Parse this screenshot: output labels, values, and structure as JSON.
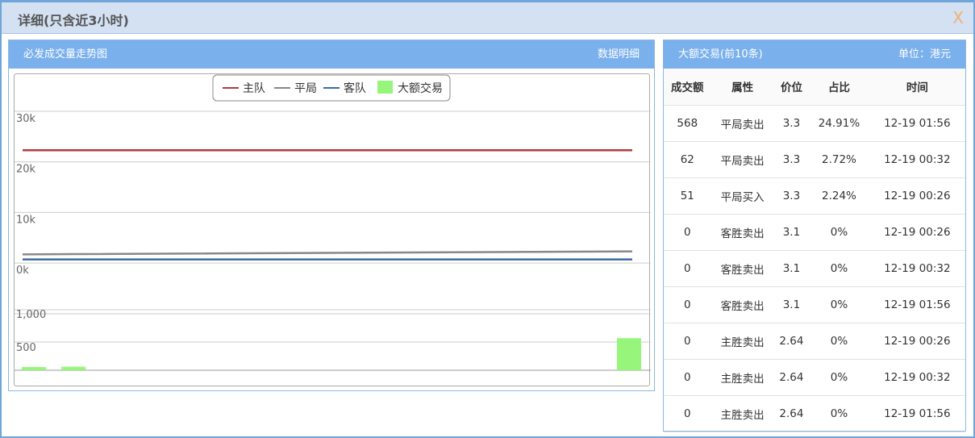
{
  "dialog": {
    "title": "详细(只含近3小时)",
    "close": "X"
  },
  "left_panel": {
    "title": "必发成交量走势图",
    "link": "数据明细"
  },
  "right_panel": {
    "title": "大额交易(前10条)",
    "unit": "单位：港元",
    "columns": [
      "成交额",
      "属性",
      "价位",
      "占比",
      "时间"
    ],
    "rows": [
      [
        "568",
        "平局卖出",
        "3.3",
        "24.91%",
        "12-19 01:56"
      ],
      [
        "62",
        "平局卖出",
        "3.3",
        "2.72%",
        "12-19 00:32"
      ],
      [
        "51",
        "平局买入",
        "3.3",
        "2.24%",
        "12-19 00:26"
      ],
      [
        "0",
        "客胜卖出",
        "3.1",
        "0%",
        "12-19 00:26"
      ],
      [
        "0",
        "客胜卖出",
        "3.1",
        "0%",
        "12-19 00:32"
      ],
      [
        "0",
        "客胜卖出",
        "3.1",
        "0%",
        "12-19 01:56"
      ],
      [
        "0",
        "主胜卖出",
        "2.64",
        "0%",
        "12-19 00:26"
      ],
      [
        "0",
        "主胜卖出",
        "2.64",
        "0%",
        "12-19 00:32"
      ],
      [
        "0",
        "主胜卖出",
        "2.64",
        "0%",
        "12-19 01:56"
      ]
    ]
  },
  "chart_data": {
    "type": "line",
    "x_minutes_from_0026": [
      0,
      6,
      90
    ],
    "legend": [
      "主队",
      "平局",
      "客队",
      "大额交易"
    ],
    "upper": {
      "ticks": [
        "30k",
        "20k",
        "10k",
        "0k"
      ],
      "ylim": [
        0,
        30000
      ],
      "series": [
        {
          "name": "主队",
          "color": "#b03a3a",
          "values": [
            22300,
            22300,
            22300
          ]
        },
        {
          "name": "平局",
          "color": "#888888",
          "values": [
            1700,
            1750,
            2300
          ]
        },
        {
          "name": "客队",
          "color": "#3b6aa8",
          "values": [
            700,
            700,
            700
          ]
        }
      ]
    },
    "lower": {
      "ticks": [
        "1,000",
        "500"
      ],
      "ylim": [
        0,
        1000
      ],
      "series": [
        {
          "name": "大额交易",
          "color": "#98f57c",
          "values": [
            51,
            62,
            568
          ]
        }
      ]
    }
  }
}
